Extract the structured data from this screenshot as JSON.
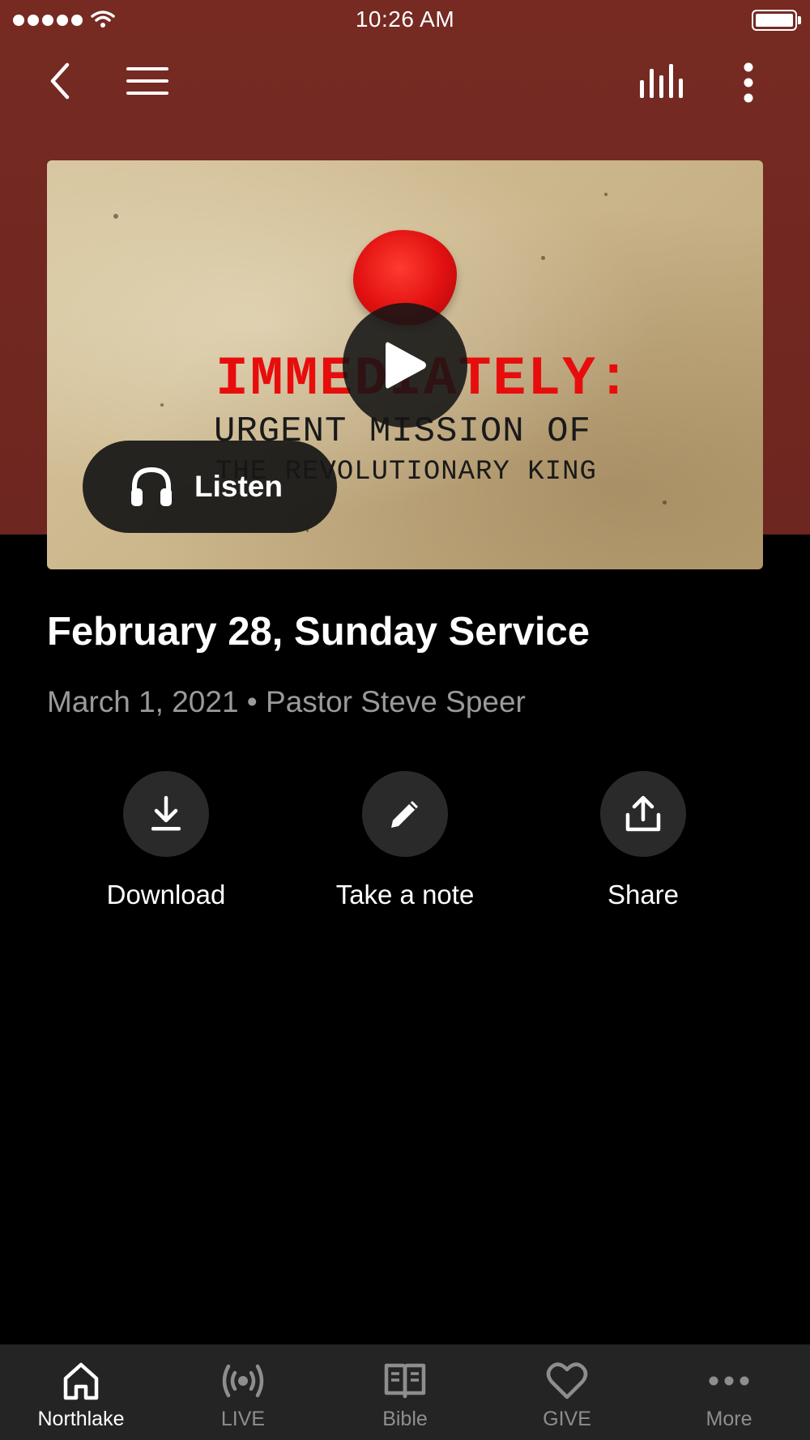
{
  "status_bar": {
    "time": "10:26 AM"
  },
  "top_nav": {
    "back_icon": "chevron-left-icon",
    "menu_icon": "hamburger-menu-icon",
    "audio_icon": "audio-bars-icon",
    "more_icon": "vertical-dots-icon"
  },
  "media": {
    "artwork_title": "IMMEDIATELY:",
    "artwork_line2": "URGENT MISSION OF",
    "artwork_line3": "THE REVOLUTIONARY KING",
    "listen_label": "Listen"
  },
  "episode": {
    "title": "February 28, Sunday Service",
    "meta": "March 1, 2021 • Pastor Steve Speer"
  },
  "actions": [
    {
      "label": "Download",
      "icon": "download-icon"
    },
    {
      "label": "Take a note",
      "icon": "pencil-icon"
    },
    {
      "label": "Share",
      "icon": "share-icon"
    }
  ],
  "tabs": [
    {
      "label": "Northlake",
      "icon": "home-icon",
      "active": true
    },
    {
      "label": "LIVE",
      "icon": "broadcast-icon",
      "active": false
    },
    {
      "label": "Bible",
      "icon": "book-icon",
      "active": false
    },
    {
      "label": "GIVE",
      "icon": "heart-icon",
      "active": false
    },
    {
      "label": "More",
      "icon": "more-dots-icon",
      "active": false
    }
  ],
  "colors": {
    "header_bg": "#762a22",
    "body_bg": "#000000",
    "tab_bar_bg": "#242424",
    "inactive_tab": "#8e8e8e",
    "meta_text": "#9a9a9a"
  }
}
